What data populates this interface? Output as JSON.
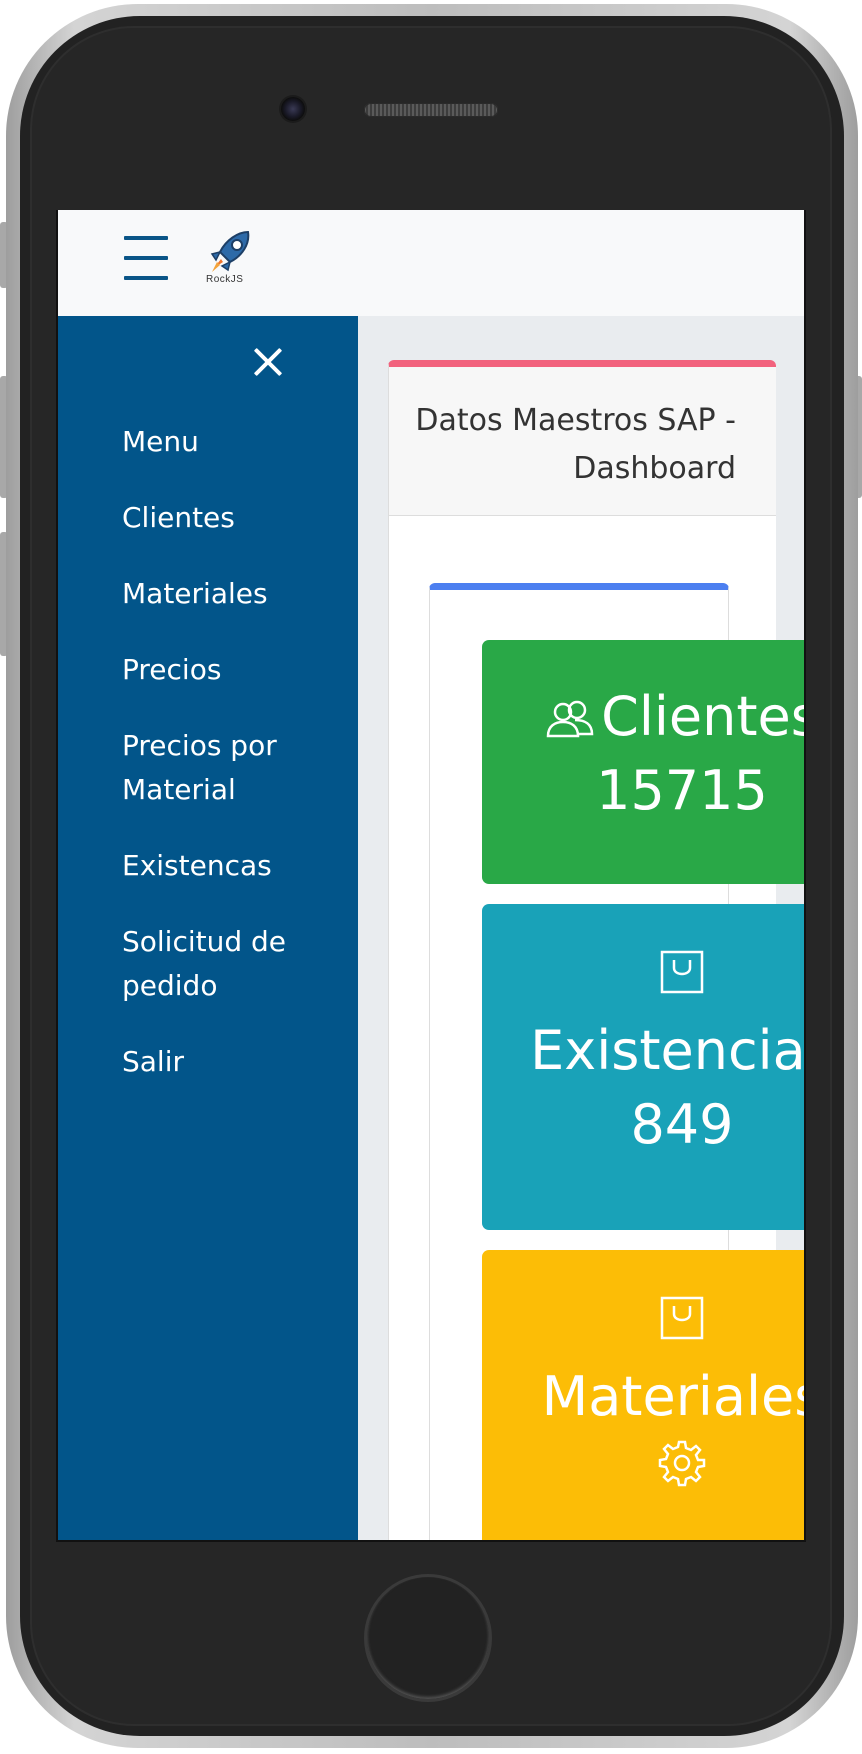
{
  "header": {
    "logo_text": "RockJS"
  },
  "sidebar": {
    "items": [
      {
        "label": "Menu"
      },
      {
        "label": "Clientes"
      },
      {
        "label": "Materiales"
      },
      {
        "label": "Precios"
      },
      {
        "label": "Precios por Material"
      },
      {
        "label": "Existencas"
      },
      {
        "label": "Solicitud de pedido"
      },
      {
        "label": "Salir"
      }
    ]
  },
  "main": {
    "card_title": "Datos Maestros SAP - Dashboard",
    "tiles": [
      {
        "label": "Clientes",
        "value": "15715",
        "icon": "users-icon",
        "color": "#29a847"
      },
      {
        "label": "Existencias",
        "value": "849",
        "icon": "shopping-bag-icon",
        "color": "#19a2b8"
      },
      {
        "label": "Materiales",
        "value": "",
        "icon": "shopping-bag-icon",
        "color": "#fcbd06"
      }
    ]
  },
  "colors": {
    "sidebar": "#02558a",
    "card_accent": "#f2627d",
    "inner_accent": "#4c7ff0"
  }
}
